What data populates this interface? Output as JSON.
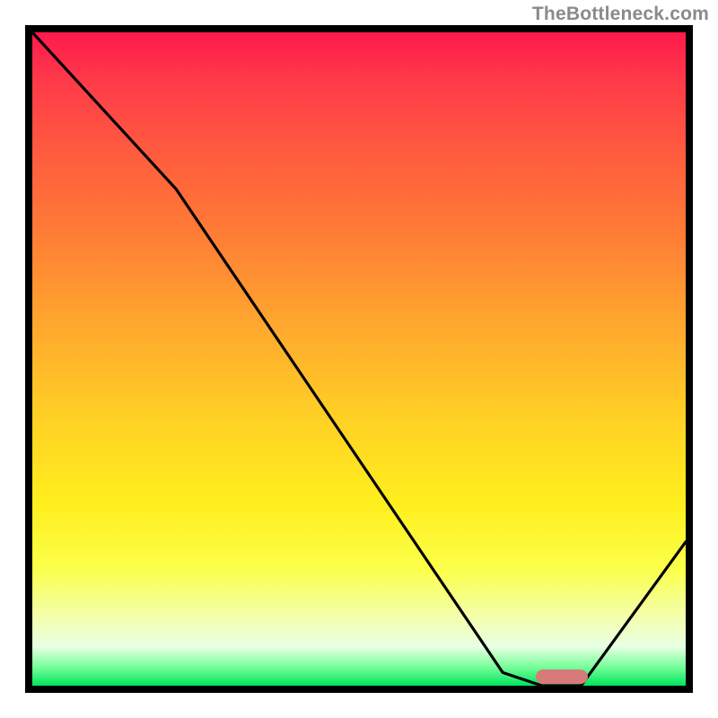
{
  "watermark": "TheBottleneck.com",
  "chart_data": {
    "type": "line",
    "title": "",
    "xlabel": "",
    "ylabel": "",
    "xlim": [
      0,
      100
    ],
    "ylim": [
      0,
      100
    ],
    "series": [
      {
        "name": "bottleneck-curve",
        "x": [
          0,
          22,
          72,
          78,
          84,
          100
        ],
        "values": [
          100,
          76,
          2,
          0,
          0,
          22
        ]
      }
    ],
    "marker": {
      "name": "optimal-range",
      "x_start": 77,
      "x_end": 85,
      "y": 0
    },
    "gradient_stops": [
      {
        "pct": 0,
        "color": "#ff1a4d"
      },
      {
        "pct": 8,
        "color": "#ff3c49"
      },
      {
        "pct": 18,
        "color": "#ff5a3f"
      },
      {
        "pct": 30,
        "color": "#ff7a36"
      },
      {
        "pct": 45,
        "color": "#ffa82e"
      },
      {
        "pct": 60,
        "color": "#ffd324"
      },
      {
        "pct": 72,
        "color": "#ffee1e"
      },
      {
        "pct": 82,
        "color": "#fbff49"
      },
      {
        "pct": 90,
        "color": "#f3ffb4"
      },
      {
        "pct": 94,
        "color": "#e8ffe4"
      },
      {
        "pct": 97,
        "color": "#7dff9d"
      },
      {
        "pct": 100,
        "color": "#00e65c"
      }
    ]
  }
}
